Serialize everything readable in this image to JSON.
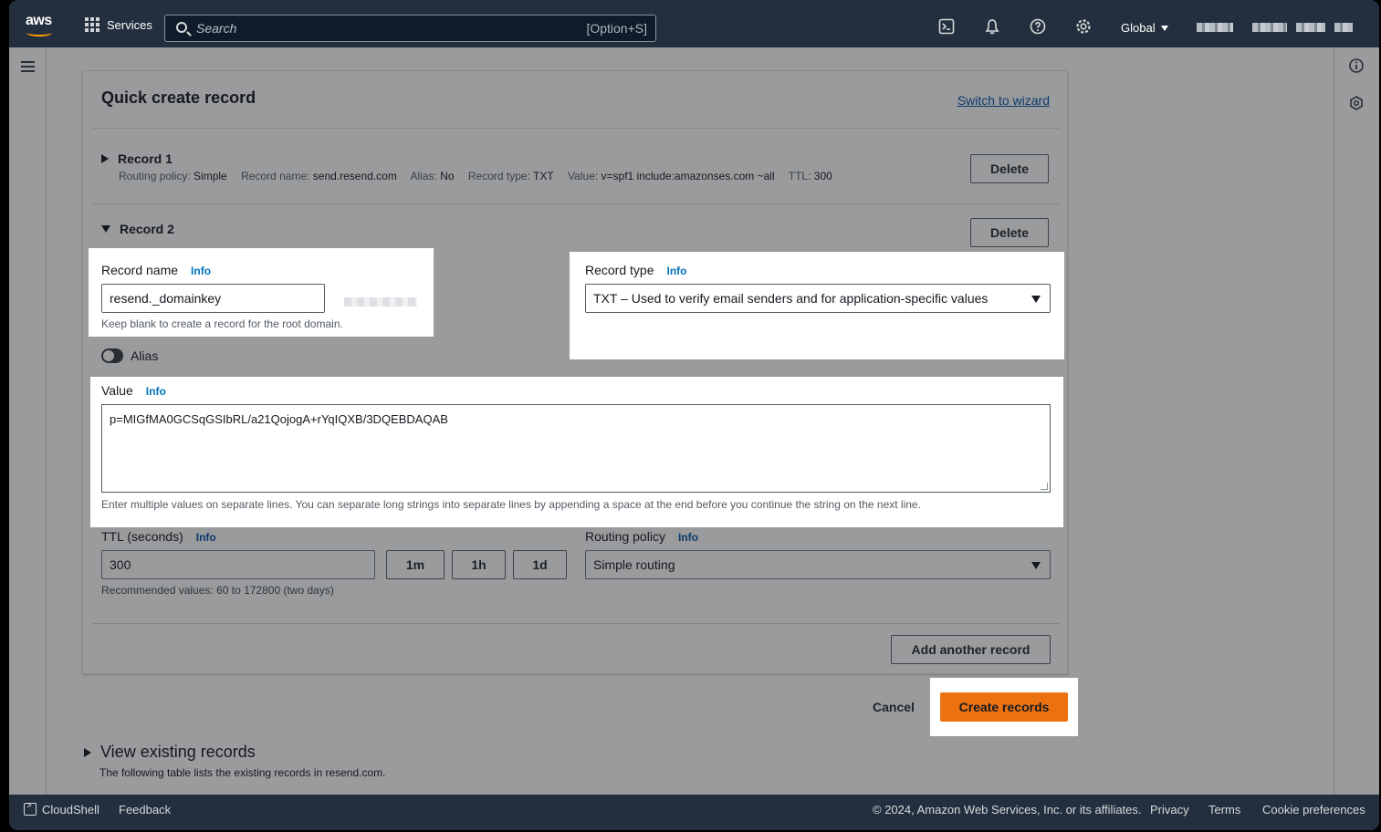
{
  "nav": {
    "logo": "aws",
    "services": "Services",
    "search_placeholder": "Search",
    "search_shortcut": "[Option+S]",
    "region": "Global"
  },
  "card": {
    "title": "Quick create record",
    "switch_link": "Switch to wizard"
  },
  "record1": {
    "heading": "Record 1",
    "delete": "Delete",
    "summary": [
      {
        "k": "Routing policy: ",
        "v": "Simple"
      },
      {
        "k": "Record name: ",
        "v": "send.resend.com"
      },
      {
        "k": "Alias: ",
        "v": "No"
      },
      {
        "k": "Record type: ",
        "v": "TXT"
      },
      {
        "k": "Value: ",
        "v": "v=spf1 include:amazonses.com ~all"
      },
      {
        "k": "TTL: ",
        "v": "300"
      }
    ]
  },
  "record2": {
    "heading": "Record 2",
    "delete": "Delete",
    "record_name_label": "Record name",
    "record_name_value": "resend._domainkey",
    "record_name_hint": "Keep blank to create a record for the root domain.",
    "record_type_label": "Record type",
    "record_type_value": "TXT – Used to verify email senders and for application-specific values",
    "alias_label": "Alias",
    "value_label": "Value",
    "value_text": "p=MIGfMA0GCSqGSIbRL/a21QojogA+rYqIQXB/3DQEBDAQAB",
    "value_hint": "Enter multiple values on separate lines. You can separate long strings into separate lines by appending a space at the end before you continue the string on the next line.",
    "ttl_label": "TTL (seconds)",
    "ttl_value": "300",
    "ttl_buttons": [
      "1m",
      "1h",
      "1d"
    ],
    "ttl_hint": "Recommended values: 60 to 172800 (two days)",
    "routing_label": "Routing policy",
    "routing_value": "Simple routing",
    "info": "Info"
  },
  "actions": {
    "add_another": "Add another record",
    "cancel": "Cancel",
    "create": "Create records"
  },
  "existing": {
    "title": "View existing records",
    "desc": "The following table lists the existing records in resend.com."
  },
  "footer": {
    "cloudshell": "CloudShell",
    "feedback": "Feedback",
    "copyright": "© 2024, Amazon Web Services, Inc. or its affiliates.",
    "privacy": "Privacy",
    "terms": "Terms",
    "cookie": "Cookie preferences"
  },
  "colors": {
    "nav_bg": "#232f3e",
    "accent": "#ec7211",
    "link": "#0073bb"
  }
}
